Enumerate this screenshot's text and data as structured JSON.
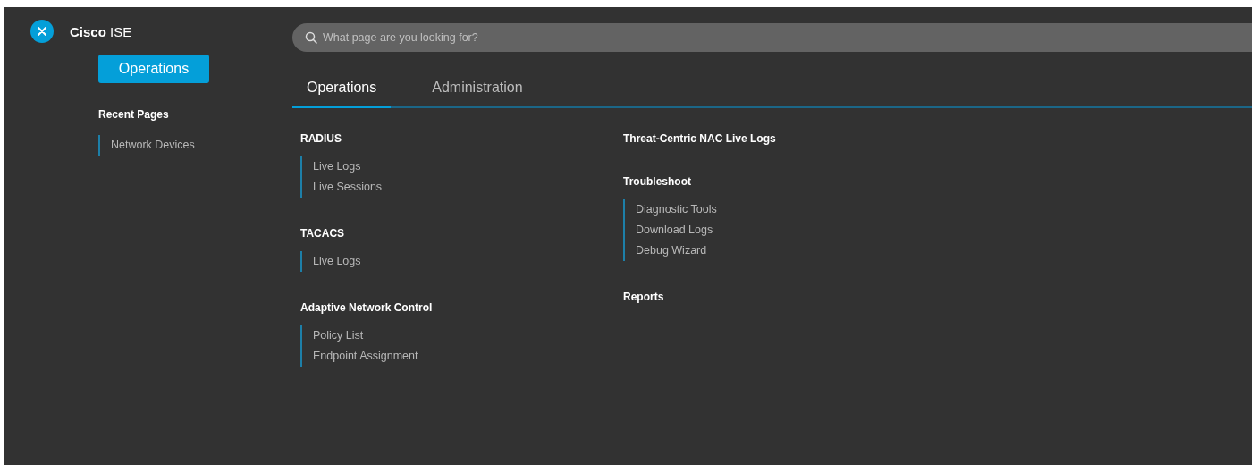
{
  "app_title": "**Cisco** ISE",
  "sidebar": {
    "button": "Operations",
    "recent_heading": "Recent Pages",
    "recent_items": [
      "Network Devices"
    ]
  },
  "search": {
    "placeholder": "What page are you looking for?"
  },
  "tabs": [
    {
      "label": "Operations",
      "selected": true
    },
    {
      "label": "Administration",
      "selected": false
    }
  ],
  "columns": [
    [
      {
        "heading": "RADIUS",
        "items": [
          "Live Logs",
          "Live Sessions"
        ]
      },
      {
        "heading": "TACACS",
        "items": [
          "Live Logs"
        ]
      },
      {
        "heading": "Adaptive Network Control",
        "items": [
          "Policy List",
          "Endpoint Assignment"
        ]
      }
    ],
    [
      {
        "heading": "Threat-Centric NAC Live Logs"
      },
      {
        "heading": "Troubleshoot",
        "items": [
          "Diagnostic Tools",
          "Download Logs",
          "Debug Wizard"
        ]
      },
      {
        "heading": "Reports"
      }
    ]
  ]
}
